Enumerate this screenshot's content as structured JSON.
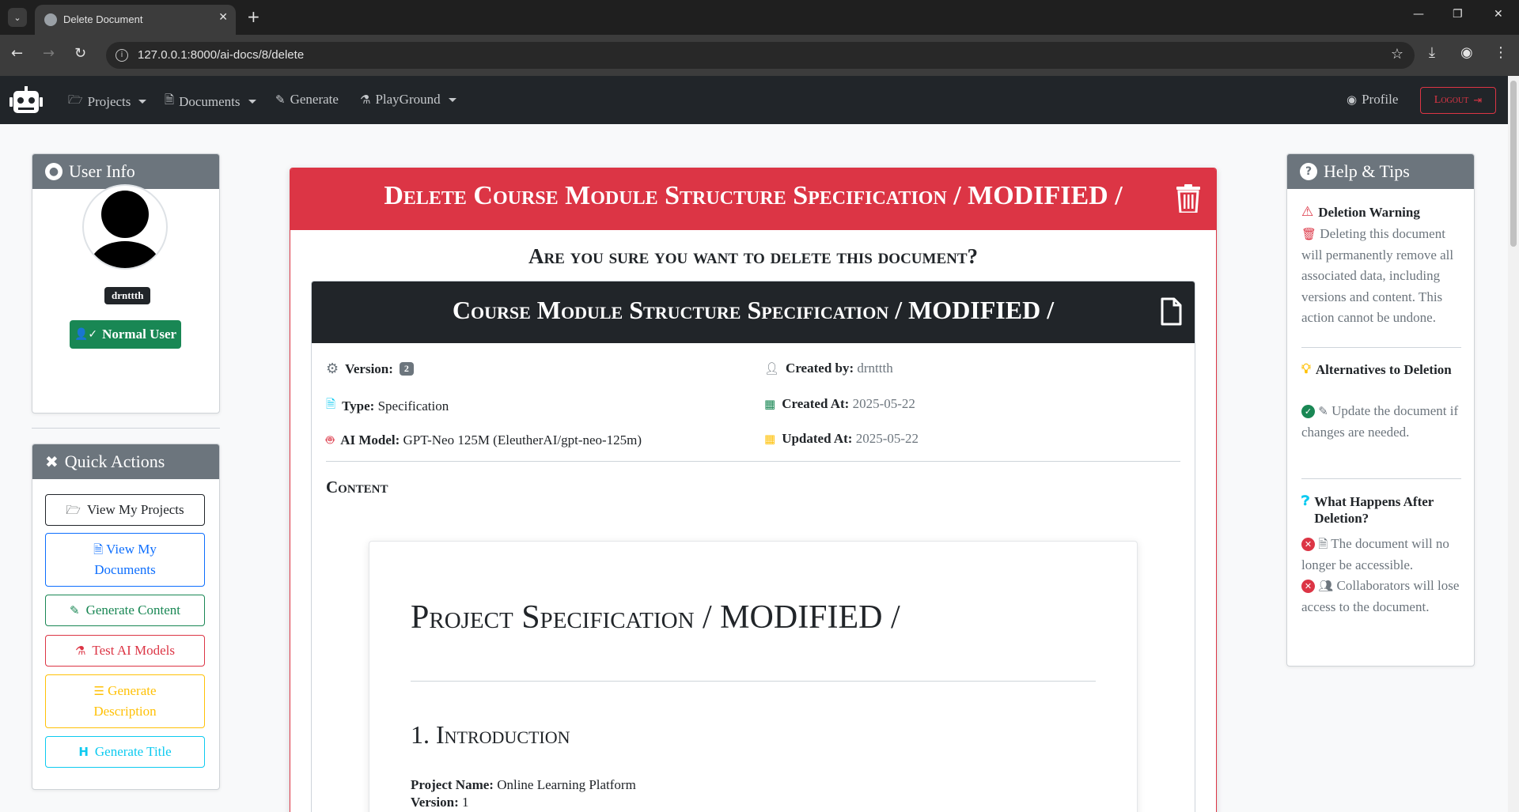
{
  "browser": {
    "tab_title": "Delete Document",
    "url": "127.0.0.1:8000/ai-docs/8/delete"
  },
  "navbar": {
    "items": [
      {
        "label": "Projects",
        "icon": "folder-open-icon"
      },
      {
        "label": "Documents",
        "icon": "file-icon"
      },
      {
        "label": "Generate",
        "icon": "pencil-icon"
      },
      {
        "label": "PlayGround",
        "icon": "flask-icon"
      }
    ],
    "profile_label": "Profile",
    "logout_label": "Logout"
  },
  "user_info": {
    "title": "User Info",
    "username": "drnttth",
    "role": "Normal User"
  },
  "quick_actions": {
    "title": "Quick Actions",
    "buttons": [
      {
        "label": "View My Projects",
        "color": "#212529"
      },
      {
        "label": "View My Documents",
        "color": "#0d6efd"
      },
      {
        "label": "Generate Content",
        "color": "#198754"
      },
      {
        "label": "Test AI Models",
        "color": "#dc3545"
      },
      {
        "label": "Generate Description",
        "color": "#ffc107"
      },
      {
        "label": "Generate Title",
        "color": "#0dcaf0"
      }
    ]
  },
  "main": {
    "danger_title": "Delete Course Module Structure Specification / MODIFIED /",
    "confirm_question": "Are you sure you want to delete this document?",
    "doc_title": "Course Module Structure Specification / MODIFIED /",
    "meta": {
      "version_label": "Version:",
      "version": "2",
      "type_label": "Type:",
      "type": "Specification",
      "ai_model_label": "AI Model:",
      "ai_model": "GPT-Neo 125M (EleutherAI/gpt-neo-125m)",
      "created_by_label": "Created by:",
      "created_by": "drnttth",
      "created_at_label": "Created At:",
      "created_at": "2025-05-22",
      "updated_at_label": "Updated At:",
      "updated_at": "2025-05-22"
    },
    "content_label": "Content",
    "content": {
      "heading": "Project Specification / MODIFIED /",
      "section": "1. Introduction",
      "project_name_label": "Project Name:",
      "project_name": "Online Learning Platform",
      "version_label": "Version:",
      "version": "1"
    }
  },
  "help": {
    "title": "Help & Tips",
    "warning_title": "Deletion Warning",
    "warning_text": "Deleting this document will permanently remove all associated data, including versions and content. This action cannot be undone.",
    "alt_title": "Alternatives to Deletion",
    "alt_text": "Update the document if changes are needed.",
    "after_title": "What Happens After Deletion?",
    "after_items": [
      "The document will no longer be accessible.",
      "Collaborators will lose access to the document."
    ]
  },
  "colors": {
    "danger": "#dc3545",
    "success": "#198754",
    "dark": "#212529",
    "secondary": "#6c757d",
    "primary": "#0d6efd",
    "warning": "#ffc107",
    "info": "#0dcaf0"
  }
}
